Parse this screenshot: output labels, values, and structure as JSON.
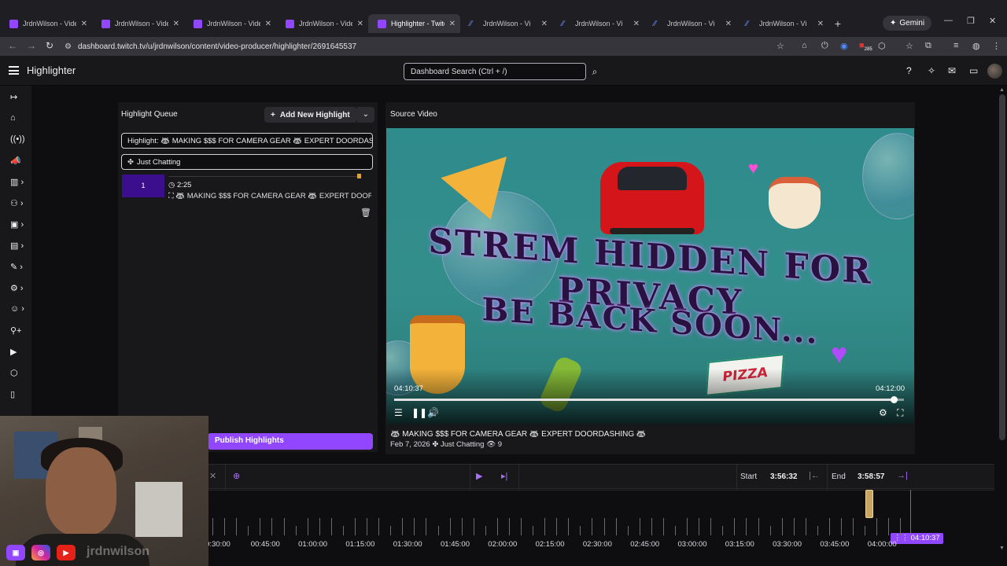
{
  "browser": {
    "tabs": [
      {
        "label": "JrdnWilson - Video",
        "active": false,
        "icon": "twitch-icon"
      },
      {
        "label": "JrdnWilson - Video",
        "active": false,
        "icon": "twitch-icon"
      },
      {
        "label": "JrdnWilson - Video",
        "active": false,
        "icon": "twitch-icon"
      },
      {
        "label": "JrdnWilson - Video",
        "active": false,
        "icon": "twitch-icon"
      },
      {
        "label": "Highlighter - Twitch",
        "active": true,
        "icon": "twitch-icon"
      },
      {
        "label": "JrdnWilson - Vi",
        "active": false,
        "icon": "link-icon"
      },
      {
        "label": "JrdnWilson - Vi",
        "active": false,
        "icon": "link-icon"
      },
      {
        "label": "JrdnWilson - Vi",
        "active": false,
        "icon": "link-icon"
      },
      {
        "label": "JrdnWilson - Vi",
        "active": false,
        "icon": "link-icon"
      }
    ],
    "gemini_label": "Gemini",
    "url": "dashboard.twitch.tv/u/jrdnwilson/content/video-producer/highlighter/2691645537",
    "ext_badge": "285"
  },
  "app": {
    "title": "Highlighter",
    "search_placeholder": "Dashboard Search (Ctrl + /)"
  },
  "queue": {
    "title": "Highlight Queue",
    "add_label": "Add New Highlight",
    "highlight_title_value": "Highlight: 🦝 MAKING $$$ FOR CAMERA GEAR 🦝 EXPERT DOORDASHING",
    "category_value": "Just Chatting",
    "items": [
      {
        "number": "1",
        "duration": "2:25",
        "title": "🦝 MAKING $$$ FOR CAMERA GEAR 🦝 EXPERT DOORDASHING"
      }
    ],
    "publish_label": "Publish Highlights"
  },
  "source": {
    "title": "Source Video",
    "overlay_line1": "STREM HIDDEN FOR PRIVACY",
    "overlay_line2": "BE BACK SOON...",
    "pizza_box_text": "PIZZA",
    "current_time": "04:10:37",
    "end_time": "04:12:00",
    "progress": 0.98,
    "video_title": "🦝 MAKING $$$ FOR CAMERA GEAR 🦝 EXPERT DOORDASHING 🦝",
    "date": "Feb 7, 2026",
    "category": "Just Chatting",
    "views": "9"
  },
  "timeline": {
    "start_label": "Start",
    "start_value": "3:56:32",
    "end_label": "End",
    "end_value": "3:58:57",
    "ticks": [
      "0:30:00",
      "00:45:00",
      "01:00:00",
      "01:15:00",
      "01:30:00",
      "01:45:00",
      "02:00:00",
      "02:15:00",
      "02:30:00",
      "02:45:00",
      "03:00:00",
      "03:15:00",
      "03:30:00",
      "03:45:00",
      "04:00:00"
    ],
    "playhead_badge": "04:10:37"
  },
  "webcam": {
    "name_overlay": "jrdnwilson"
  },
  "colors": {
    "accent": "#9147ff",
    "background": "#0e0e10",
    "panel": "#18181b"
  }
}
